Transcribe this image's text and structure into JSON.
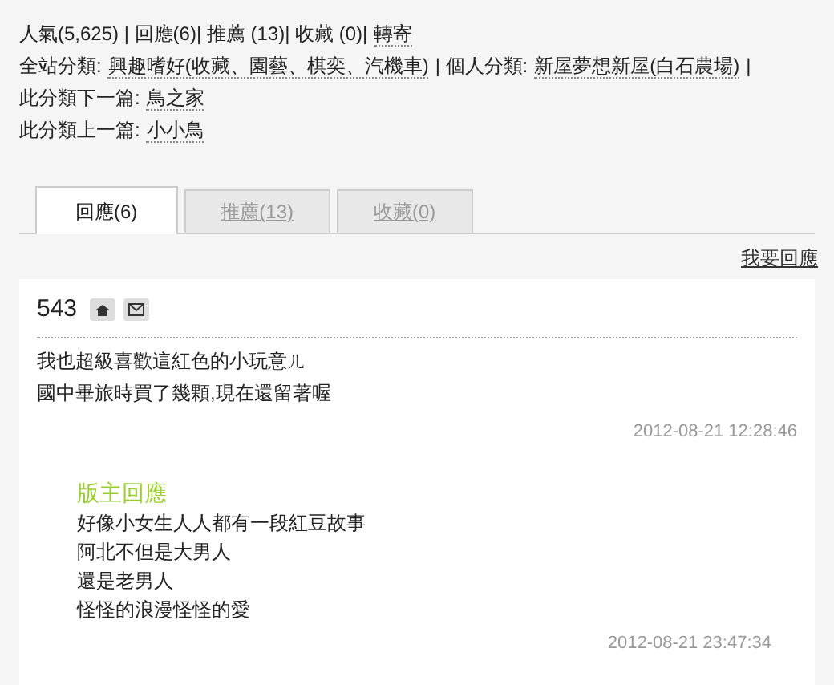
{
  "meta_lines": [
    [
      {
        "kind": "text",
        "text": "人氣(5,625) | 回應(6)| 推薦 (13)| 收藏 (0)|"
      },
      {
        "kind": "link",
        "text": "轉寄"
      }
    ],
    [
      {
        "kind": "text",
        "text": "全站分類:"
      },
      {
        "kind": "link",
        "text": "興趣嗜好(收藏、園藝、棋奕、汽機車)"
      },
      {
        "kind": "text",
        "text": "| 個人分類:"
      },
      {
        "kind": "link",
        "text": "新屋夢想新屋(白石農場)"
      },
      {
        "kind": "text",
        "text": "|"
      }
    ],
    [
      {
        "kind": "text",
        "text": "此分類下一篇:"
      },
      {
        "kind": "link",
        "text": "鳥之家"
      }
    ],
    [
      {
        "kind": "text",
        "text": "此分類上一篇:"
      },
      {
        "kind": "link",
        "text": "小小鳥"
      }
    ]
  ],
  "tabs": [
    {
      "label": "回應(6)",
      "selected": true
    },
    {
      "label": "推薦(13)",
      "selected": false
    },
    {
      "label": "收藏(0)",
      "selected": false
    }
  ],
  "reply_link": "我要回應",
  "comment": {
    "author": "543",
    "lines": [
      "我也超級喜歡這紅色的小玩意ㄦ",
      "國中畢旅時買了幾顆,現在還留著喔"
    ],
    "time": "2012-08-21 12:28:46",
    "owner_reply": {
      "title": "版主回應",
      "lines": [
        "好像小女生人人都有一段紅豆故事",
        "阿北不但是大男人",
        "還是老男人",
        "怪怪的浪漫怪怪的愛"
      ],
      "time": "2012-08-21 23:47:34"
    }
  }
}
